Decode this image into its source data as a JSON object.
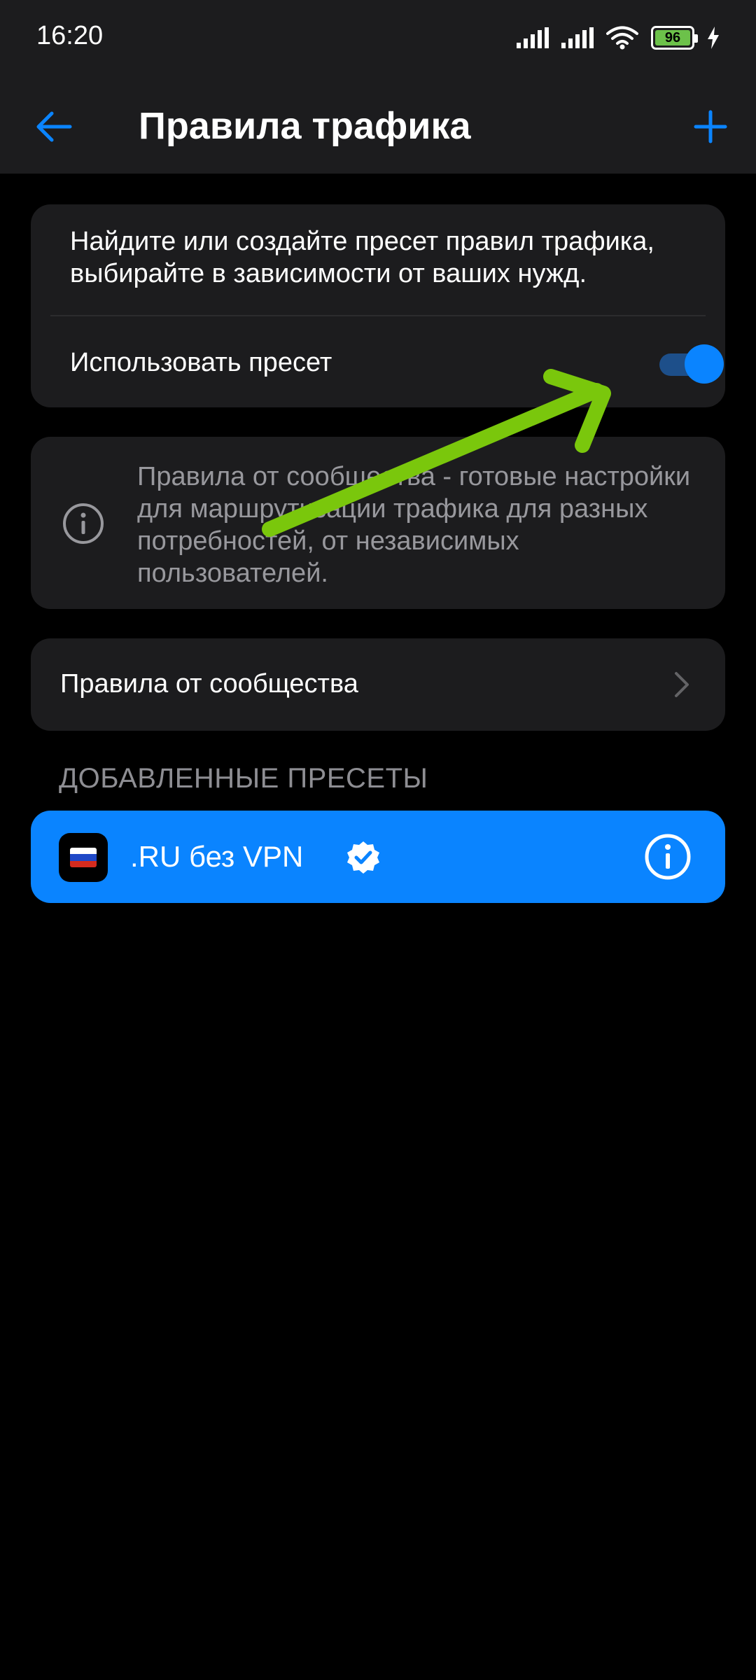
{
  "status_bar": {
    "time": "16:20",
    "battery": "96",
    "icons": [
      "signal-icon",
      "signal-icon",
      "wifi-icon",
      "battery-icon",
      "charging-icon"
    ]
  },
  "header": {
    "title": "Правила трафика",
    "back_icon": "arrow-left-icon",
    "add_icon": "plus-icon"
  },
  "preset_card": {
    "description": "Найдите или создайте пресет правил трафика, выбирайте в зависимости от ваших нужд.",
    "toggle_label": "Использовать пресет",
    "toggle_on": true
  },
  "info_card": {
    "text": "Правила от сообщества - готовые настройки для маршрутизации трафика для разных потребностей, от независимых пользователей."
  },
  "community_row": {
    "label": "Правила от сообщества"
  },
  "added_presets": {
    "header": "ДОБАВЛЕННЫЕ ПРЕСЕТЫ",
    "items": [
      {
        "name": ".RU без VPN",
        "verified": true,
        "icon": "russia-flag-icon"
      }
    ]
  },
  "colors": {
    "accent": "#0a84ff",
    "background": "#000000",
    "card": "#1c1c1e",
    "annotation_arrow": "#7ac70c"
  }
}
